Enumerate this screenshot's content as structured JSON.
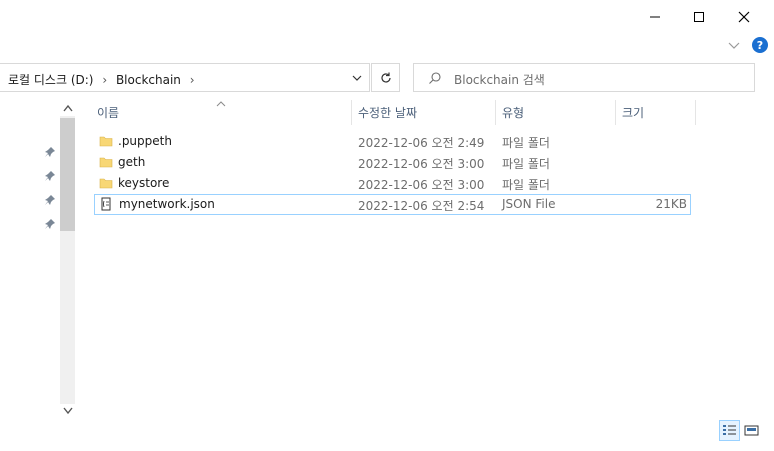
{
  "window": {
    "minimize_icon": "minimize-icon",
    "maximize_icon": "maximize-icon",
    "close_icon": "close-icon",
    "help_label": "?"
  },
  "address": {
    "path": "로컬 디스크 (D:)  ›  Blockchain  ›",
    "segments": [
      "로컬 디스크 (D:)",
      "Blockchain"
    ]
  },
  "search": {
    "placeholder": "Blockchain 검색"
  },
  "columns": {
    "name": "이름",
    "date": "수정한 날짜",
    "type": "유형",
    "size": "크기"
  },
  "files": [
    {
      "name": ".puppeth",
      "date": "2022-12-06 오전 2:49",
      "type": "파일 폴더",
      "size": "",
      "icon": "folder-icon"
    },
    {
      "name": "geth",
      "date": "2022-12-06 오전 3:00",
      "type": "파일 폴더",
      "size": "",
      "icon": "folder-icon"
    },
    {
      "name": "keystore",
      "date": "2022-12-06 오전 3:00",
      "type": "파일 폴더",
      "size": "",
      "icon": "folder-icon"
    },
    {
      "name": "mynetwork.json",
      "date": "2022-12-06 오전 2:54",
      "type": "JSON File",
      "size": "21KB",
      "icon": "json-file-icon"
    }
  ],
  "colors": {
    "accent": "#1a6fd1",
    "selection_border": "#99d1ff",
    "folder": "#f8d775"
  }
}
